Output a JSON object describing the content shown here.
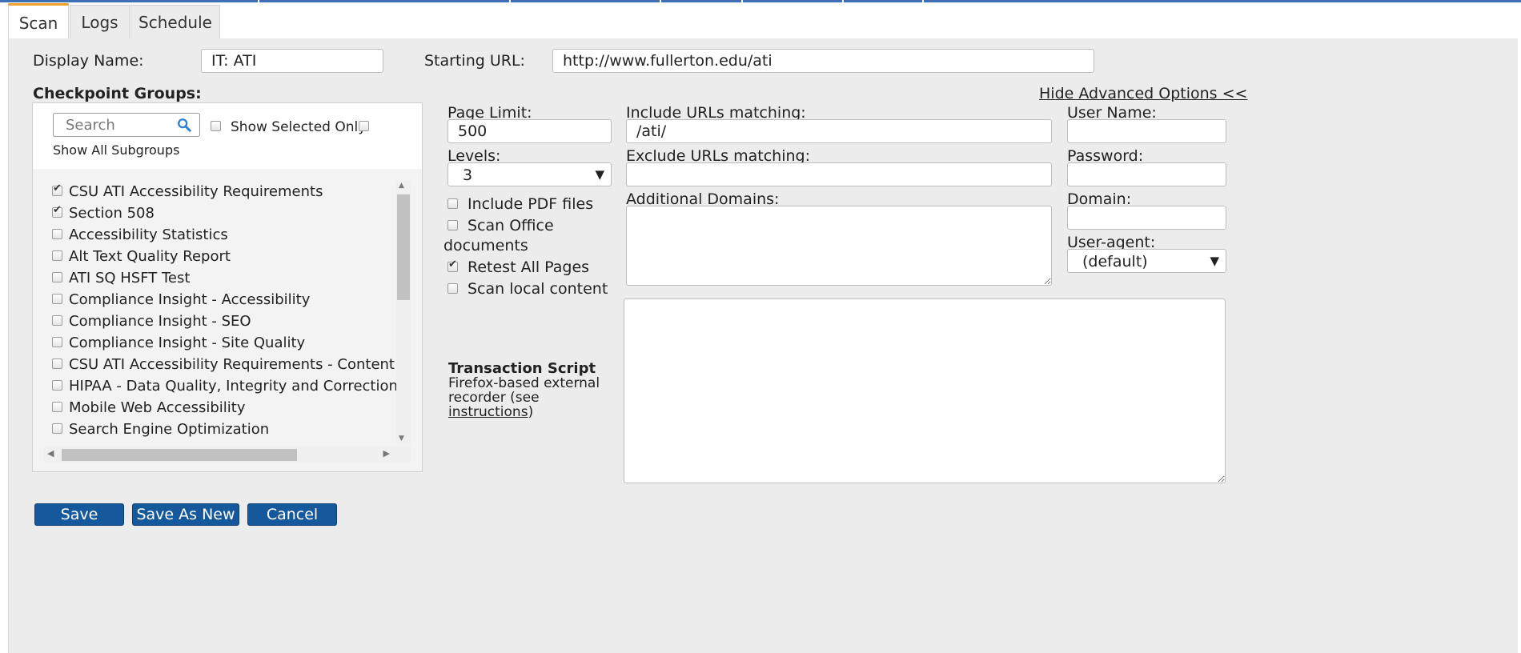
{
  "tabs": [
    {
      "label": "Scan",
      "active": true
    },
    {
      "label": "Logs",
      "active": false
    },
    {
      "label": "Schedule",
      "active": false
    }
  ],
  "form": {
    "display_name_label": "Display Name:",
    "display_name_value": "IT: ATI",
    "starting_url_label": "Starting URL:",
    "starting_url_value": "http://www.fullerton.edu/ati"
  },
  "checkpoint_groups": {
    "heading": "Checkpoint Groups:",
    "search_placeholder": "Search",
    "show_selected_only": "Show Selected Only",
    "show_all_subgroups": "Show All Subgroups",
    "items": [
      {
        "label": "CSU ATI Accessibility Requirements",
        "checked": true
      },
      {
        "label": "Section 508",
        "checked": true
      },
      {
        "label": "Accessibility Statistics",
        "checked": false
      },
      {
        "label": "Alt Text Quality Report",
        "checked": false
      },
      {
        "label": "ATI SQ HSFT Test",
        "checked": false
      },
      {
        "label": "Compliance Insight - Accessibility",
        "checked": false
      },
      {
        "label": "Compliance Insight - SEO",
        "checked": false
      },
      {
        "label": "Compliance Insight - Site Quality",
        "checked": false
      },
      {
        "label": "CSU ATI Accessibility Requirements - Content Crea",
        "checked": false
      },
      {
        "label": "HIPAA - Data Quality, Integrity and Correction",
        "checked": false
      },
      {
        "label": "Mobile Web Accessibility",
        "checked": false
      },
      {
        "label": "Search Engine Optimization",
        "checked": false
      }
    ]
  },
  "advanced": {
    "toggle_link": "Hide Advanced Options <<",
    "page_limit_label": "Page Limit:",
    "page_limit_value": "500",
    "levels_label": "Levels:",
    "levels_value": "3",
    "include_pdf": "Include PDF files",
    "scan_office_1": "Scan Office",
    "scan_office_2": "documents",
    "retest_all": "Retest All Pages",
    "scan_local": "Scan local content",
    "include_urls_label": "Include URLs matching:",
    "include_urls_value": "/ati/",
    "exclude_urls_label": "Exclude URLs matching:",
    "exclude_urls_value": "",
    "additional_domains_label": "Additional Domains:",
    "user_name_label": "User Name:",
    "password_label": "Password:",
    "domain_label": "Domain:",
    "user_agent_label": "User-agent:",
    "user_agent_value": "(default)"
  },
  "transaction": {
    "title": "Transaction Script",
    "line1": "Firefox-based external",
    "line2": "recorder (see",
    "link": "instructions",
    "close": ")"
  },
  "buttons": {
    "save": "Save",
    "save_as_new": "Save As New",
    "cancel": "Cancel"
  },
  "colors": {
    "primary_button": "#16589c",
    "active_tab_accent": "#f0a030",
    "top_strip": "#3d6fb4"
  }
}
